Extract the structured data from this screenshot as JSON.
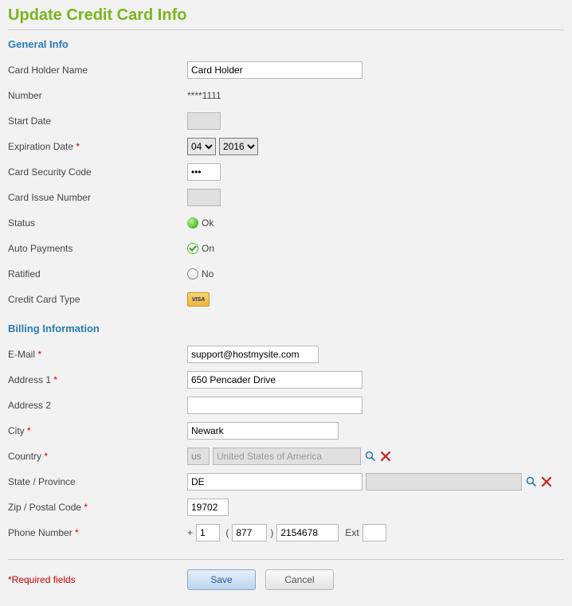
{
  "pageTitle": "Update Credit Card Info",
  "sections": {
    "general": "General Info",
    "billing": "Billing Information"
  },
  "labels": {
    "cardHolderName": "Card Holder Name",
    "number": "Number",
    "startDate": "Start Date",
    "expirationDate": "Expiration Date",
    "cardSecurityCode": "Card Security Code",
    "cardIssueNumber": "Card Issue Number",
    "status": "Status",
    "autoPayments": "Auto Payments",
    "ratified": "Ratified",
    "creditCardType": "Credit Card Type",
    "email": "E-Mail",
    "address1": "Address 1",
    "address2": "Address 2",
    "city": "City",
    "country": "Country",
    "stateProvince": "State / Province",
    "zip": "Zip / Postal Code",
    "phone": "Phone Number",
    "ext": "Ext"
  },
  "values": {
    "cardHolderName": "Card Holder",
    "numberMasked": "****1111",
    "expMonth": "04",
    "expYear": "2016",
    "securityCode": "•••",
    "statusText": "Ok",
    "autoPaymentsText": "On",
    "ratifiedText": "No",
    "ccTypeBadge": "VISA",
    "email": "support@hostmysite.com",
    "address1": "650 Pencader Drive",
    "address2": "",
    "city": "Newark",
    "countryCode": "us",
    "countryName": "United States of America",
    "stateCode": "DE",
    "stateName": "",
    "zip": "19702",
    "phoneCountry": "1",
    "phoneArea": "877",
    "phoneNumber": "2154678",
    "phoneExt": ""
  },
  "buttons": {
    "save": "Save",
    "cancel": "Cancel"
  },
  "footer": {
    "requiredNote": "*Required fields"
  }
}
